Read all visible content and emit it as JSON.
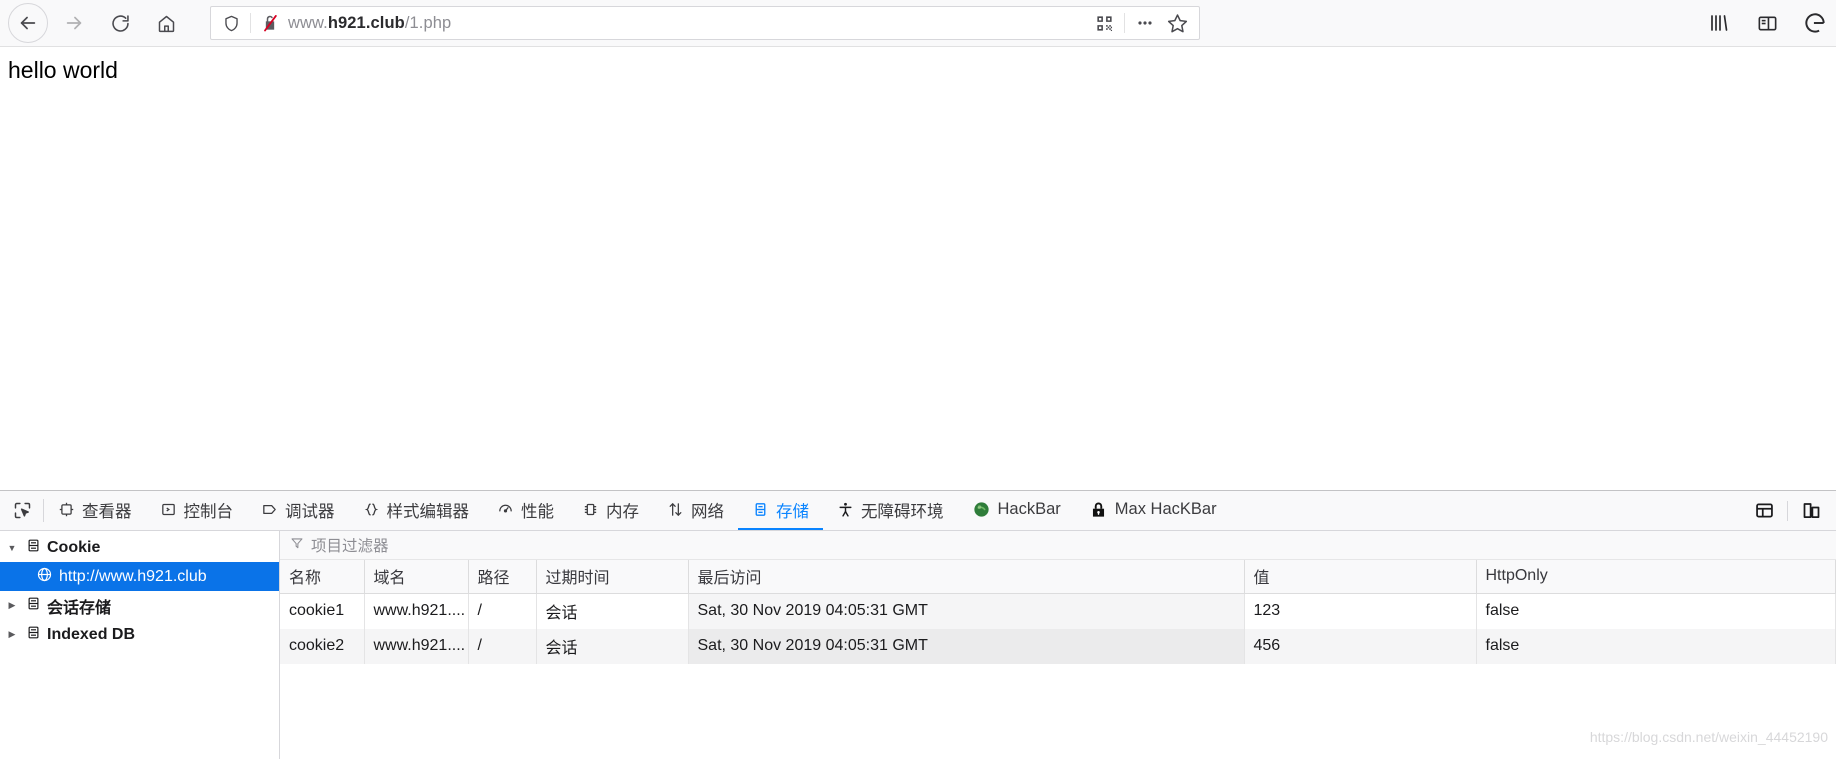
{
  "browser": {
    "nav": {
      "back_label": "Back",
      "forward_label": "Forward",
      "reload_label": "Reload",
      "home_label": "Home"
    },
    "urlbar": {
      "url_prefix": "www.",
      "url_domain": "h921.club",
      "url_suffix": "/1.php",
      "full_url": "www.h921.club/1.php",
      "shield_icon": "shield-icon",
      "insecure_icon": "broken-lock-icon",
      "qr_icon": "qr-code-icon",
      "more_icon": "ellipsis-icon",
      "bookmark_icon": "star-icon"
    },
    "chrome_right": {
      "library_icon": "library-icon",
      "sidebar_icon": "sidebar-icon",
      "account_icon": "account-icon"
    }
  },
  "page": {
    "body_text": "hello world"
  },
  "devtools": {
    "picker_icon": "element-picker-icon",
    "tabs": [
      {
        "label": "查看器",
        "icon": "inspector-icon",
        "active": false
      },
      {
        "label": "控制台",
        "icon": "console-icon",
        "active": false
      },
      {
        "label": "调试器",
        "icon": "debugger-icon",
        "active": false
      },
      {
        "label": "样式编辑器",
        "icon": "style-editor-icon",
        "active": false
      },
      {
        "label": "性能",
        "icon": "performance-icon",
        "active": false
      },
      {
        "label": "内存",
        "icon": "memory-icon",
        "active": false
      },
      {
        "label": "网络",
        "icon": "network-icon",
        "active": false
      },
      {
        "label": "存储",
        "icon": "storage-icon",
        "active": true
      },
      {
        "label": "无障碍环境",
        "icon": "accessibility-icon",
        "active": false
      },
      {
        "label": "HackBar",
        "icon": "hackbar-icon",
        "active": false
      },
      {
        "label": "Max HacKBar",
        "icon": "max-hackbar-lock-icon",
        "active": false
      }
    ],
    "right_buttons": [
      {
        "name": "dock-layout-button",
        "icon": "dock-layout-icon"
      },
      {
        "name": "responsive-design-mode-button",
        "icon": "responsive-mode-icon"
      }
    ],
    "accent_color": "#0a84ff"
  },
  "storage": {
    "tree": [
      {
        "label": "Cookie",
        "icon": "storage-type-icon",
        "expanded": true,
        "level": 0,
        "selected": false
      },
      {
        "label": "http://www.h921.club",
        "icon": "globe-icon",
        "level": 1,
        "selected": true
      },
      {
        "label": "会话存储",
        "icon": "storage-type-icon",
        "expanded": false,
        "level": 0,
        "selected": false
      },
      {
        "label": "Indexed DB",
        "icon": "storage-type-icon",
        "expanded": false,
        "level": 0,
        "selected": false
      }
    ],
    "filter": {
      "placeholder": "项目过滤器",
      "value": "",
      "icon": "filter-funnel-icon"
    },
    "columns": [
      "名称",
      "域名",
      "路径",
      "过期时间",
      "最后访问",
      "值",
      "HttpOnly"
    ],
    "rows": [
      {
        "名称": "cookie1",
        "域名": "www.h921....",
        "路径": "/",
        "过期时间": "会话",
        "最后访问": "Sat, 30 Nov 2019 04:05:31 GMT",
        "值": "123",
        "HttpOnly": "false"
      },
      {
        "名称": "cookie2",
        "域名": "www.h921....",
        "路径": "/",
        "过期时间": "会话",
        "最后访问": "Sat, 30 Nov 2019 04:05:31 GMT",
        "值": "456",
        "HttpOnly": "false"
      }
    ],
    "selected_row_color": "#0a73e8",
    "watermark": "https://blog.csdn.net/weixin_44452190"
  }
}
